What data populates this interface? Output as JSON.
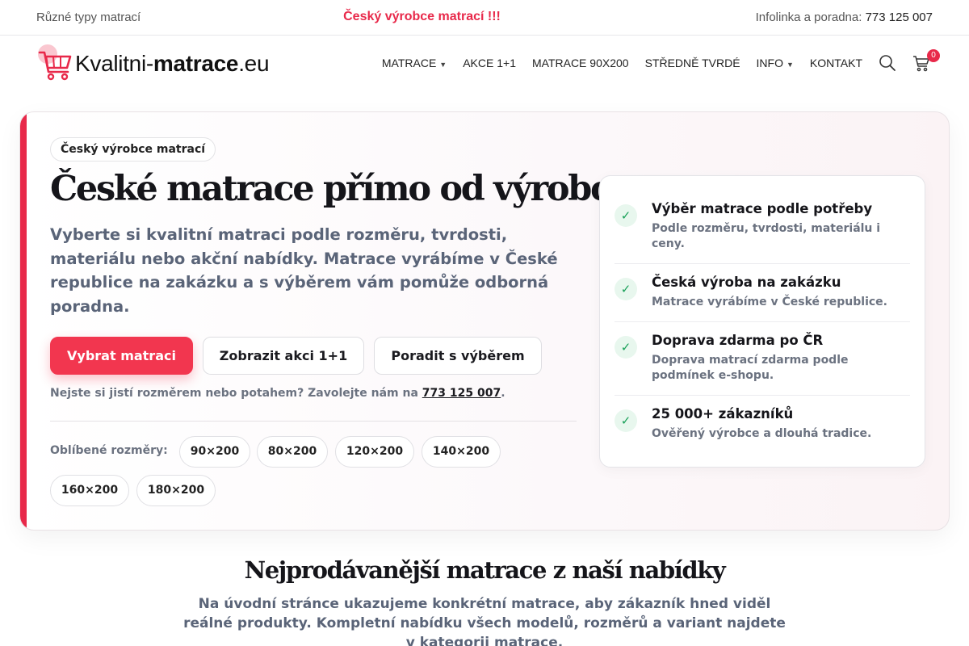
{
  "topbar": {
    "left_text": "Různé typy matrací",
    "center_text": "Český výrobce matrací !!!",
    "right_label": "Infolinka a poradna: ",
    "right_phone": "773 125 007"
  },
  "header": {
    "logo_prefix": "Kvalitni-",
    "logo_bold": "matrace",
    "logo_suffix": ".eu",
    "nav": [
      {
        "label": "MATRACE",
        "has_caret": true
      },
      {
        "label": "AKCE 1+1",
        "has_caret": false
      },
      {
        "label": "MATRACE 90X200",
        "has_caret": false
      },
      {
        "label": "STŘEDNĚ TVRDÉ",
        "has_caret": false
      },
      {
        "label": "INFO",
        "has_caret": true
      },
      {
        "label": "KONTAKT",
        "has_caret": false
      }
    ],
    "cart_count": "0"
  },
  "hero": {
    "badge": "Český výrobce matrací",
    "title": "České matrace přímo od výrobce",
    "lead": "Vyberte si kvalitní matraci podle rozměru, tvrdosti, materiálu nebo akční nabídky. Matrace vyrábíme v České republice na zakázku a s výběrem vám pomůže odborná poradna.",
    "buttons": {
      "primary": "Vybrat matraci",
      "secondary": "Zobrazit akci 1+1",
      "tertiary": "Poradit s výběrem"
    },
    "note_text": "Nejste si jistí rozměrem nebo potahem? Zavolejte nám na ",
    "note_phone": "773 125 007",
    "note_end": ".",
    "sizes_label": "Oblíbené rozměry:",
    "sizes": [
      "90×200",
      "80×200",
      "120×200",
      "140×200",
      "160×200",
      "180×200"
    ]
  },
  "features": [
    {
      "title": "Výběr matrace podle potřeby",
      "desc": "Podle rozměru, tvrdosti, materiálu i ceny."
    },
    {
      "title": "Česká výroba na zakázku",
      "desc": "Matrace vyrábíme v České republice."
    },
    {
      "title": "Doprava zdarma po ČR",
      "desc": "Doprava matrací zdarma podle podmínek e-shopu."
    },
    {
      "title": "25 000+ zákazníků",
      "desc": "Ověřený výrobce a dlouhá tradice."
    }
  ],
  "section": {
    "title": "Nejprodávanější matrace z naší nabídky",
    "text": "Na úvodní stránce ukazujeme konkrétní matrace, aby zákazník hned viděl reálné produkty. Kompletní nabídku všech modelů, rozměrů a variant najdete v kategorii matrace."
  },
  "colors": {
    "accent": "#e8294a",
    "button": "#f2364f",
    "check_green": "#18a058"
  }
}
